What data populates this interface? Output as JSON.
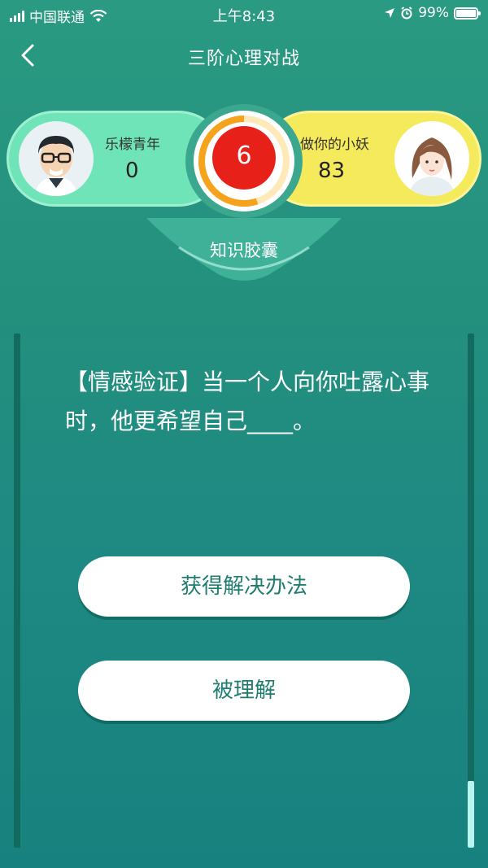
{
  "status_bar": {
    "carrier": "中国联通",
    "time": "上午8:43",
    "battery": "99%",
    "battery_level": 0.99
  },
  "nav": {
    "title": "三阶心理对战"
  },
  "battle": {
    "left_player": {
      "name": "乐檬青年",
      "score": "0"
    },
    "right_player": {
      "name": "做你的小妖",
      "score": "83"
    },
    "timer": "6",
    "timer_progress": 0.55
  },
  "capsule_label": "知识胶囊",
  "question": {
    "text": "【情感验证】当一个人向你吐露心事时，他更希望自己____。"
  },
  "answers": [
    {
      "label": "获得解决办法"
    },
    {
      "label": "被理解"
    }
  ],
  "progress": {
    "value": 0.13
  },
  "colors": {
    "background": "#23907e",
    "left_player": "#6fe4b9",
    "right_player": "#f5ea5b",
    "timer_red": "#e8201a",
    "timer_ring": "#f5a31c"
  }
}
